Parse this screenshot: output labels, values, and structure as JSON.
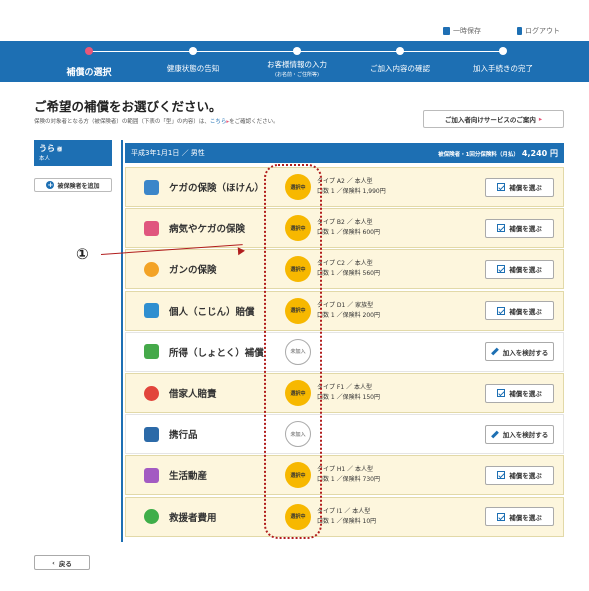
{
  "header": {
    "save_label": "一時保存",
    "logout_label": "ログアウト"
  },
  "steps": [
    {
      "label": "補償の選択",
      "sub": "",
      "active": true
    },
    {
      "label": "健康状態の告知",
      "sub": "",
      "active": false
    },
    {
      "label": "お客様情報の入力",
      "sub": "(お名前・ご住所等)",
      "active": false
    },
    {
      "label": "ご加入内容の確認",
      "sub": "",
      "active": false
    },
    {
      "label": "加入手続きの完了",
      "sub": "",
      "active": false
    }
  ],
  "page": {
    "title": "ご希望の補償をお選びください。",
    "subtitle_pre": "保険の対象者となる方（被保険者）の範囲（下表の「型」の内容）は、",
    "subtitle_link": "こちら",
    "subtitle_post": "をご確認ください。",
    "service_button": "ご加入者向けサービスのご案内"
  },
  "insured": {
    "name": "うら",
    "honorific": "様",
    "relation": "本人",
    "add_button": "被保険者を追加"
  },
  "plan_header": {
    "date_gender": "平成3年1月1日 ／ 男性",
    "premium_label": "被保険者・1回分保険料（月払）",
    "premium_value": "4,240 円"
  },
  "coverages": [
    {
      "name": "ケガの保険（ほけん）",
      "icon": "injury-person-icon",
      "color": "#3b86c9",
      "status": "選択中",
      "selected": true,
      "type_line": "タイプ A2 ／ 本人型",
      "fee_line": "口数 1 ／保険料 1,990円",
      "button": "補償を選ぶ"
    },
    {
      "name": "病気やケガの保険",
      "icon": "hospital-icon",
      "color": "#e0567e",
      "status": "選択中",
      "selected": true,
      "type_line": "タイプ B2 ／ 本人型",
      "fee_line": "口数 1 ／保険料 600円",
      "button": "補償を選ぶ"
    },
    {
      "name": "ガンの保険",
      "icon": "cancer-cell-icon",
      "color": "#f3a326",
      "status": "選択中",
      "selected": true,
      "type_line": "タイプ C2 ／ 本人型",
      "fee_line": "口数 1 ／保険料 560円",
      "button": "補償を選ぶ"
    },
    {
      "name": "個人（こじん）賠償",
      "icon": "liability-icon",
      "color": "#2f8fd0",
      "status": "選択中",
      "selected": true,
      "type_line": "タイプ D1 ／ 家族型",
      "fee_line": "口数 1 ／保険料 200円",
      "button": "補償を選ぶ"
    },
    {
      "name": "所得（しょとく）補償",
      "icon": "income-icon",
      "color": "#45a94a",
      "status": "未加入",
      "selected": false,
      "type_line": "",
      "fee_line": "",
      "button": "加入を検討する"
    },
    {
      "name": "借家人賠責",
      "icon": "building-icon",
      "color": "#e2453c",
      "status": "選択中",
      "selected": true,
      "type_line": "タイプ F1 ／ 本人型",
      "fee_line": "口数 1 ／保険料 150円",
      "button": "補償を選ぶ"
    },
    {
      "name": "携行品",
      "icon": "camera-bag-icon",
      "color": "#2c6aa8",
      "status": "未加入",
      "selected": false,
      "type_line": "",
      "fee_line": "",
      "button": "加入を検討する"
    },
    {
      "name": "生活動産",
      "icon": "household-goods-icon",
      "color": "#a35bc2",
      "status": "選択中",
      "selected": true,
      "type_line": "タイプ H1 ／ 本人型",
      "fee_line": "口数 1 ／保険料 730円",
      "button": "補償を選ぶ"
    },
    {
      "name": "救援者費用",
      "icon": "airplane-icon",
      "color": "#3fae49",
      "status": "選択中",
      "selected": true,
      "type_line": "タイプ I1 ／ 本人型",
      "fee_line": "口数 1 ／保険料 10円",
      "button": "補償を選ぶ"
    }
  ],
  "annotation": {
    "marker": "①"
  },
  "back_button": "戻る"
}
